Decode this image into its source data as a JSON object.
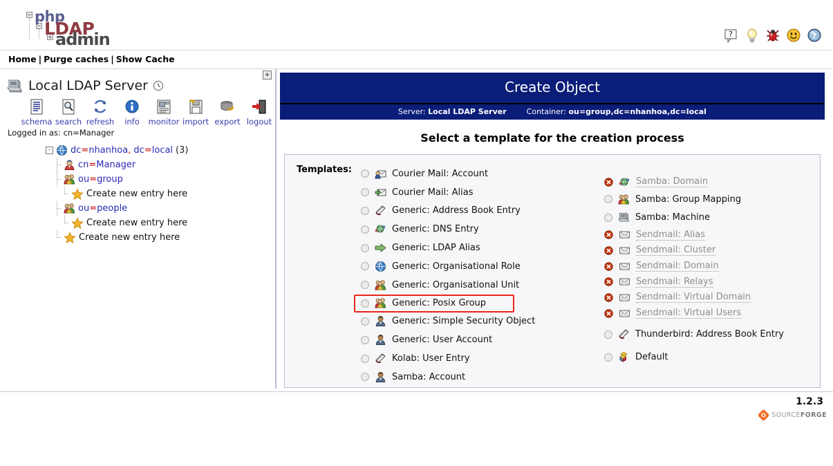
{
  "app": {
    "logo_php": "php",
    "logo_ldap": "LDAP",
    "logo_admin": "admin",
    "version": "1.2.3",
    "sourceforge_light": "SOURCE",
    "sourceforge_bold": "FORGE"
  },
  "topicons": [
    {
      "name": "help-question-icon",
      "title": "?"
    },
    {
      "name": "lightbulb-icon",
      "title": "Tip"
    },
    {
      "name": "bug-icon",
      "title": "Report a bug"
    },
    {
      "name": "smiley-icon",
      "title": "Feedback"
    },
    {
      "name": "help-sphere-icon",
      "title": "Help"
    }
  ],
  "navbar": {
    "home": "Home",
    "purge_caches": "Purge caches",
    "show_cache": "Show Cache",
    "separator": "|"
  },
  "sidebar": {
    "collapse_label": "+",
    "server_name": "Local LDAP Server",
    "clock_icon": "clock-icon",
    "toolbar": [
      {
        "name": "schema",
        "label": "schema",
        "icon": "schema-icon"
      },
      {
        "name": "search",
        "label": "search",
        "icon": "search-icon"
      },
      {
        "name": "refresh",
        "label": "refresh",
        "icon": "refresh-icon"
      },
      {
        "name": "info",
        "label": "info",
        "icon": "info-icon"
      },
      {
        "name": "monitor",
        "label": "monitor",
        "icon": "monitor-icon"
      },
      {
        "name": "import",
        "label": "import",
        "icon": "import-icon"
      },
      {
        "name": "export",
        "label": "export",
        "icon": "export-icon"
      },
      {
        "name": "logout",
        "label": "logout",
        "icon": "logout-icon"
      }
    ],
    "logged_in_as": "Logged in as: cn=Manager",
    "tree": {
      "root": {
        "expander": "-",
        "label_parts": [
          "dc",
          "=",
          "nhanhoa",
          ", ",
          "dc",
          "=",
          "local"
        ],
        "label": "dc=nhanhoa, dc=local",
        "count": "(3)",
        "icon": "globe-icon"
      },
      "children": [
        {
          "label": "cn=Manager",
          "icon": "user-icon",
          "type": "entry"
        },
        {
          "label": "ou=group",
          "icon": "group-icon",
          "type": "entry"
        },
        {
          "label": "Create new entry here",
          "icon": "star-icon",
          "type": "create"
        },
        {
          "label": "ou=people",
          "icon": "group-icon",
          "type": "entry"
        },
        {
          "label": "Create new entry here",
          "icon": "star-icon",
          "type": "create"
        },
        {
          "label": "Create new entry here",
          "icon": "star-icon",
          "type": "create-root"
        }
      ]
    }
  },
  "main": {
    "title": "Create Object",
    "server_label": "Server:",
    "server_value": "Local LDAP Server",
    "container_label": "Container:",
    "container_value": "ou=group,dc=nhanhoa,dc=local",
    "section_title": "Select a template for the creation process",
    "templates_label": "Templates:",
    "colors": {
      "header_blue": "#0a1d78",
      "highlight_red": "#e8261b",
      "link_blue": "#2a2ab5",
      "disabled_grey": "#8e8e8e"
    },
    "templates_left": [
      {
        "label": "Courier Mail: Account",
        "icon": "mail-user-icon",
        "enabled": true,
        "selected": false,
        "highlighted": false
      },
      {
        "label": "Courier Mail: Alias",
        "icon": "mail-arrow-icon",
        "enabled": true,
        "selected": false,
        "highlighted": false
      },
      {
        "label": "Generic: Address Book Entry",
        "icon": "address-book-icon",
        "enabled": true,
        "selected": false,
        "highlighted": false
      },
      {
        "label": "Generic: DNS Entry",
        "icon": "dns-globe-icon",
        "enabled": true,
        "selected": false,
        "highlighted": false
      },
      {
        "label": "Generic: LDAP Alias",
        "icon": "arrow-right-icon",
        "enabled": true,
        "selected": false,
        "highlighted": false
      },
      {
        "label": "Generic: Organisational Role",
        "icon": "globe-icon",
        "enabled": true,
        "selected": false,
        "highlighted": false
      },
      {
        "label": "Generic: Organisational Unit",
        "icon": "group-icon",
        "enabled": true,
        "selected": false,
        "highlighted": false
      },
      {
        "label": "Generic: Posix Group",
        "icon": "group-icon",
        "enabled": true,
        "selected": false,
        "highlighted": true
      },
      {
        "label": "Generic: Simple Security Object",
        "icon": "user-icon",
        "enabled": true,
        "selected": false,
        "highlighted": false
      },
      {
        "label": "Generic: User Account",
        "icon": "user-icon",
        "enabled": true,
        "selected": false,
        "highlighted": false
      },
      {
        "label": "Kolab: User Entry",
        "icon": "address-book-icon",
        "enabled": true,
        "selected": false,
        "highlighted": false
      },
      {
        "label": "Samba: Account",
        "icon": "user-icon",
        "enabled": true,
        "selected": false,
        "highlighted": false
      }
    ],
    "templates_right": [
      {
        "label": "Samba: Domain",
        "icon": "dns-globe-icon",
        "enabled": false,
        "selected": false,
        "highlighted": false
      },
      {
        "label": "Samba: Group Mapping",
        "icon": "group-icon",
        "enabled": true,
        "selected": false,
        "highlighted": false
      },
      {
        "label": "Samba: Machine",
        "icon": "computer-icon",
        "enabled": true,
        "selected": false,
        "highlighted": false
      },
      {
        "label": "Sendmail: Alias",
        "icon": "envelope-icon",
        "enabled": false,
        "selected": false,
        "highlighted": false
      },
      {
        "label": "Sendmail: Cluster",
        "icon": "envelope-icon",
        "enabled": false,
        "selected": false,
        "highlighted": false
      },
      {
        "label": "Sendmail: Domain",
        "icon": "envelope-icon",
        "enabled": false,
        "selected": false,
        "highlighted": false
      },
      {
        "label": "Sendmail: Relays",
        "icon": "envelope-icon",
        "enabled": false,
        "selected": false,
        "highlighted": false
      },
      {
        "label": "Sendmail: Virtual Domain",
        "icon": "envelope-icon",
        "enabled": false,
        "selected": false,
        "highlighted": false
      },
      {
        "label": "Sendmail: Virtual Users",
        "icon": "envelope-icon",
        "enabled": false,
        "selected": false,
        "highlighted": false
      },
      {
        "label": "Thunderbird: Address Book Entry",
        "icon": "address-book-icon",
        "enabled": true,
        "selected": false,
        "highlighted": false
      },
      {
        "label": "Default",
        "icon": "blocks-icon",
        "enabled": true,
        "selected": false,
        "highlighted": false
      }
    ]
  }
}
